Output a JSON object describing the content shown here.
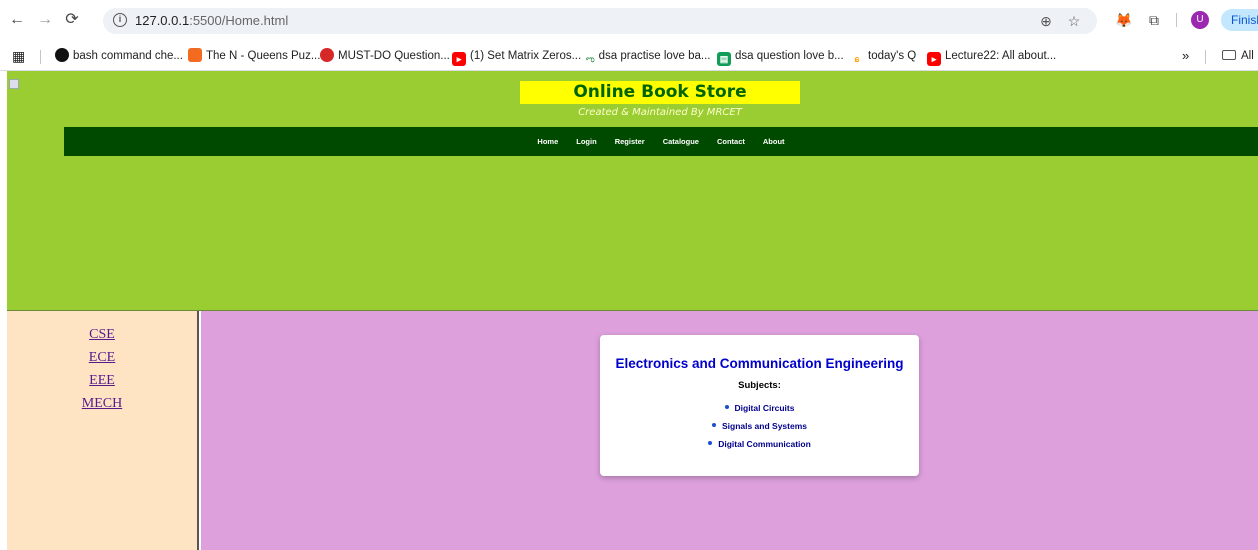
{
  "browser": {
    "url_host": "127.0.0.1",
    "url_path": ":5500/Home.html",
    "profile_initial": "U",
    "finish_label": "Finish",
    "all_bookmarks_label": "All",
    "bookmarks": [
      {
        "label": "bash command che...",
        "icon": "github-icon"
      },
      {
        "label": "The N - Queens Puz...",
        "icon": "codingninjas-icon"
      },
      {
        "label": "MUST-DO Question...",
        "icon": "takeuforward-icon"
      },
      {
        "label": "(1) Set Matrix Zeros...",
        "icon": "youtube-icon"
      },
      {
        "label": "dsa practise love ba...",
        "icon": "geeksforgeeks-icon"
      },
      {
        "label": "dsa question love b...",
        "icon": "sheets-icon"
      },
      {
        "label": "today's Q",
        "icon": "leetcode-icon"
      },
      {
        "label": "Lecture22: All about...",
        "icon": "youtube-icon"
      }
    ]
  },
  "site": {
    "title": "Online Book Store",
    "subtitle": "Created & Maintained By MRCET",
    "menu": [
      "Home",
      "Login",
      "Register",
      "Catalogue",
      "Contact",
      "About"
    ]
  },
  "sidebar": {
    "links": [
      "CSE",
      "ECE",
      "EEE",
      "MECH"
    ]
  },
  "content": {
    "heading": "Electronics and Communication Engineering",
    "subjects_label": "Subjects:",
    "subjects": [
      "Digital Circuits",
      "Signals and Systems",
      "Digital Communication"
    ]
  },
  "colors": {
    "header_bg": "#9acd32",
    "menubar_bg": "#004a00",
    "title_bg": "#ffff00",
    "sidebar_bg": "#ffe4c4",
    "main_bg": "#dda0dd"
  }
}
